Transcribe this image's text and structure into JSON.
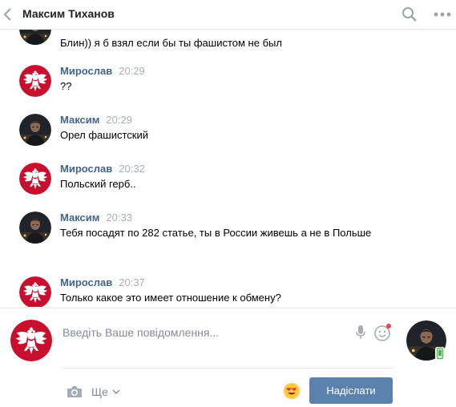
{
  "header": {
    "title": "Максим Тиханов",
    "back_icon": "chevron-left-icon",
    "search_icon": "search-icon",
    "more_icon": "more-dots-icon"
  },
  "messages": [
    {
      "sender": "",
      "time": "",
      "avatar": "polish-eagle",
      "text": "Блин)) я б взял если бы ты фашистом не был"
    },
    {
      "sender": "Мирослав",
      "time": "20:29",
      "avatar": "polish-eagle",
      "text": "??"
    },
    {
      "sender": "Максим",
      "time": "20:29",
      "avatar": "dark-photo",
      "text": "Орел фашистский"
    },
    {
      "sender": "Мирослав",
      "time": "20:32",
      "avatar": "polish-eagle",
      "text": "Польский герб.."
    },
    {
      "sender": "Максим",
      "time": "20:33",
      "avatar": "dark-photo",
      "text": "Тебя посадят по 282 статье, ты в России живешь а не в Польше"
    },
    {
      "sender": "Мирослав",
      "time": "20:37",
      "avatar": "polish-eagle",
      "text": "Только какое это имеет отношение к обмену?"
    }
  ],
  "composer": {
    "placeholder": "Введіть Ваше повідомлення...",
    "more_label": "Ще",
    "send_label": "Надіслати"
  },
  "colors": {
    "sender": "#42648b",
    "time": "#a8adb3",
    "send_button": "#5b82ad",
    "eagle_bg": "#c8102e"
  }
}
